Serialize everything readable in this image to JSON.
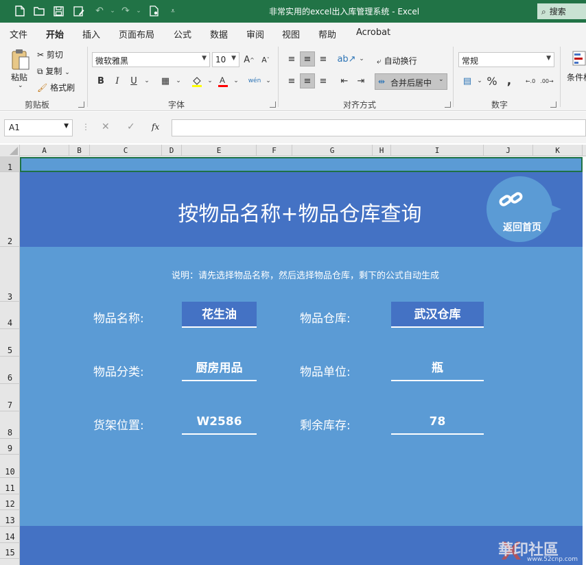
{
  "titlebar": {
    "title": "非常实用的excel出入库管理系统  -  Excel",
    "search": "搜索"
  },
  "menu": {
    "tabs": [
      "文件",
      "开始",
      "插入",
      "页面布局",
      "公式",
      "数据",
      "审阅",
      "视图",
      "帮助",
      "Acrobat"
    ],
    "active": "开始"
  },
  "ribbon": {
    "clipboard": {
      "paste": "粘贴",
      "cut": "剪切",
      "copy": "复制",
      "format_painter": "格式刷",
      "group": "剪贴板"
    },
    "font": {
      "name": "微软雅黑",
      "size": "10",
      "group": "字体",
      "bold": "B",
      "italic": "I",
      "underline": "U"
    },
    "alignment": {
      "wrap": "自动换行",
      "merge": "合并后居中",
      "group": "对齐方式"
    },
    "number": {
      "format": "常规",
      "group": "数字",
      "percent": "%"
    },
    "styles": {
      "conditional": "条件格"
    }
  },
  "formula_bar": {
    "name_box": "A1",
    "fx": "fx",
    "formula": ""
  },
  "columns": [
    "A",
    "B",
    "C",
    "D",
    "E",
    "F",
    "G",
    "H",
    "I",
    "J",
    "K"
  ],
  "rows": [
    "1",
    "2",
    "3",
    "4",
    "5",
    "6",
    "7",
    "8",
    "9",
    "10",
    "11",
    "12",
    "13",
    "14",
    "15"
  ],
  "sheet": {
    "title": "按物品名称+物品仓库查询",
    "return_label": "返回首页",
    "note": "说明：请先选择物品名称，然后选择物品仓库，剩下的公式自动生成",
    "fields": {
      "name_label": "物品名称:",
      "name_value": "花生油",
      "warehouse_label": "物品仓库:",
      "warehouse_value": "武汉仓库",
      "category_label": "物品分类:",
      "category_value": "厨房用品",
      "unit_label": "物品单位:",
      "unit_value": "瓶",
      "shelf_label": "货架位置:",
      "shelf_value": "W2586",
      "stock_label": "剩余库存:",
      "stock_value": "78"
    }
  },
  "watermark": {
    "text": "華印社區",
    "sub": "www.52cnp.com"
  },
  "colors": {
    "excel_green": "#217346",
    "header_band": "#4472c4",
    "body_band": "#5b9bd5"
  }
}
